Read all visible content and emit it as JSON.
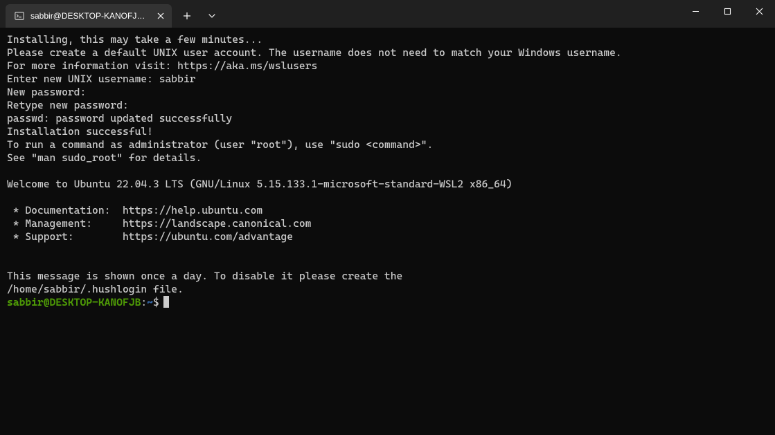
{
  "titlebar": {
    "tab": {
      "icon": "terminal-icon",
      "title": "sabbir@DESKTOP-KANOFJB: ~"
    }
  },
  "terminal": {
    "lines": [
      "Installing, this may take a few minutes...",
      "Please create a default UNIX user account. The username does not need to match your Windows username.",
      "For more information visit: https://aka.ms/wslusers",
      "Enter new UNIX username: sabbir",
      "New password:",
      "Retype new password:",
      "passwd: password updated successfully",
      "Installation successful!",
      "To run a command as administrator (user \"root\"), use \"sudo <command>\".",
      "See \"man sudo_root\" for details.",
      "",
      "Welcome to Ubuntu 22.04.3 LTS (GNU/Linux 5.15.133.1-microsoft-standard-WSL2 x86_64)",
      "",
      " * Documentation:  https://help.ubuntu.com",
      " * Management:     https://landscape.canonical.com",
      " * Support:        https://ubuntu.com/advantage",
      "",
      "",
      "This message is shown once a day. To disable it please create the",
      "/home/sabbir/.hushlogin file."
    ],
    "prompt": {
      "user_host": "sabbir@DESKTOP-KANOFJB",
      "colon": ":",
      "path": "~",
      "symbol": "$"
    }
  }
}
